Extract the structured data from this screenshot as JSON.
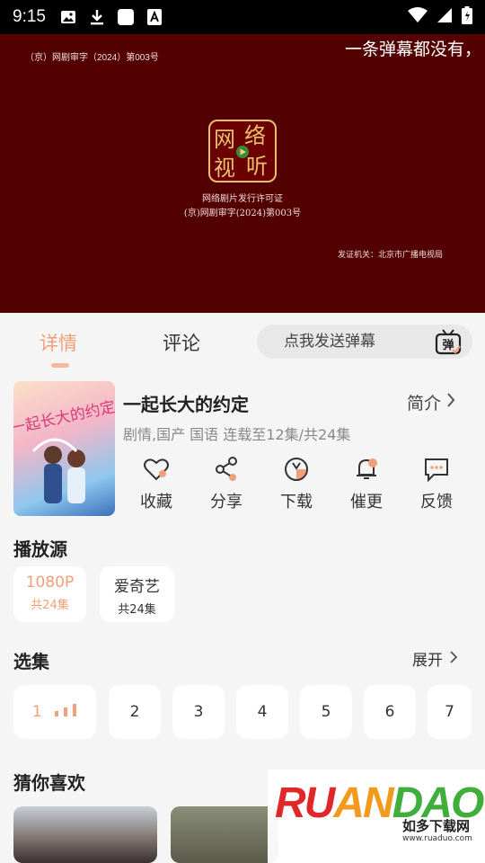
{
  "status_bar": {
    "time": "9:15"
  },
  "player": {
    "license_top": "（京）网剧审字（2024）第003号",
    "danmaku_text": "一条弹幕都没有，",
    "seal_glyphs": [
      "网",
      "络",
      "视",
      "听"
    ],
    "license_name": "网络剧片发行许可证",
    "license_number": "(京)网剧审字(2024)第003号",
    "issuer": "发证机关：北京市广播电视局"
  },
  "tabs": [
    {
      "label": "详情",
      "active": true
    },
    {
      "label": "评论",
      "active": false
    }
  ],
  "danmaku_input": {
    "placeholder": "点我发送弹幕",
    "button_label": "弹"
  },
  "show": {
    "title": "一起长大的约定",
    "intro_label": "简介",
    "meta": "剧情,国产 国语 连载至12集/共24集",
    "poster_text": "一起长大的约定"
  },
  "actions": [
    {
      "label": "收藏",
      "icon": "heart-icon"
    },
    {
      "label": "分享",
      "icon": "share-icon"
    },
    {
      "label": "下载",
      "icon": "download-icon"
    },
    {
      "label": "催更",
      "icon": "bell-icon"
    },
    {
      "label": "反馈",
      "icon": "feedback-icon"
    }
  ],
  "sources_section": {
    "title": "播放源",
    "items": [
      {
        "name": "1080P",
        "count": "共24集",
        "selected": true
      },
      {
        "name": "爱奇艺",
        "count": "共24集",
        "selected": false
      }
    ]
  },
  "episodes_section": {
    "title": "选集",
    "expand_label": "展开",
    "items": [
      "1",
      "2",
      "3",
      "4",
      "5",
      "6",
      "7"
    ],
    "playing": "1"
  },
  "recommend_section": {
    "title": "猜你喜欢"
  },
  "watermark": {
    "logo": "RUANDAO",
    "cn": "如多下载网",
    "url": "www.ruaduo.com"
  },
  "colors": {
    "accent": "#f0a07a",
    "player_bg": "#520000",
    "page_bg": "#f5f5f5"
  }
}
